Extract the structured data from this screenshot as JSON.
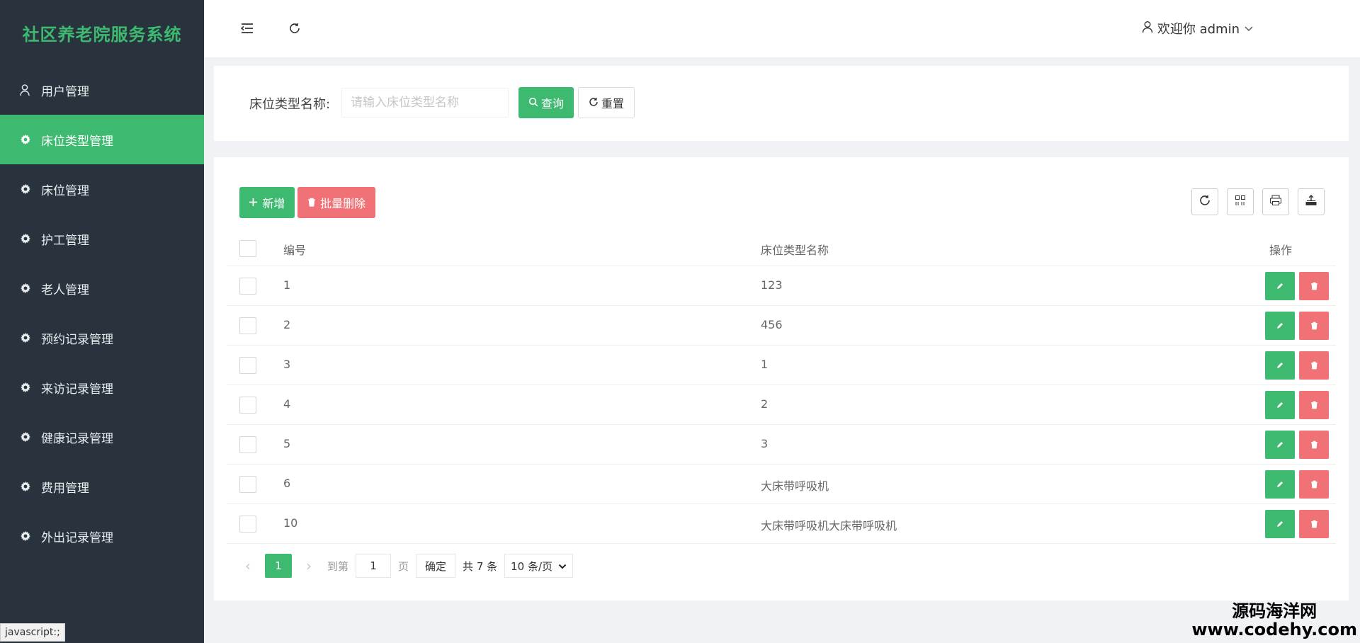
{
  "app": {
    "title": "社区养老院服务系统"
  },
  "sidebar": {
    "items": [
      {
        "label": "用户管理",
        "icon": "user-icon",
        "active": false
      },
      {
        "label": "床位类型管理",
        "icon": "gear-icon",
        "active": true
      },
      {
        "label": "床位管理",
        "icon": "gear-icon",
        "active": false
      },
      {
        "label": "护工管理",
        "icon": "gear-icon",
        "active": false
      },
      {
        "label": "老人管理",
        "icon": "gear-icon",
        "active": false
      },
      {
        "label": "预约记录管理",
        "icon": "gear-icon",
        "active": false
      },
      {
        "label": "来访记录管理",
        "icon": "gear-icon",
        "active": false
      },
      {
        "label": "健康记录管理",
        "icon": "gear-icon",
        "active": false
      },
      {
        "label": "费用管理",
        "icon": "gear-icon",
        "active": false
      },
      {
        "label": "外出记录管理",
        "icon": "gear-icon",
        "active": false
      }
    ]
  },
  "header": {
    "user_label": "欢迎你 admin"
  },
  "search": {
    "label": "床位类型名称:",
    "placeholder": "请输入床位类型名称",
    "value": "",
    "query_label": "查询",
    "reset_label": "重置"
  },
  "toolbar": {
    "add_label": "新增",
    "batch_delete_label": "批量删除"
  },
  "table": {
    "headers": {
      "id": "编号",
      "name": "床位类型名称",
      "ops": "操作"
    },
    "rows": [
      {
        "id": "1",
        "name": "123"
      },
      {
        "id": "2",
        "name": "456"
      },
      {
        "id": "3",
        "name": "1"
      },
      {
        "id": "4",
        "name": "2"
      },
      {
        "id": "5",
        "name": "3"
      },
      {
        "id": "6",
        "name": "大床带呼吸机"
      },
      {
        "id": "10",
        "name": "大床带呼吸机大床带呼吸机"
      }
    ]
  },
  "pagination": {
    "current": "1",
    "goto_label": "到第",
    "page_input": "1",
    "page_suffix": "页",
    "confirm_label": "确定",
    "total_label": "共 7 条",
    "page_size": "10 条/页"
  },
  "status_bar": "javascript:;",
  "watermark": {
    "line1": "源码海洋网",
    "line2": "www.codehy.com"
  },
  "colors": {
    "primary": "#3dba6f",
    "danger": "#f07176",
    "sidebar_bg": "#28333e"
  }
}
